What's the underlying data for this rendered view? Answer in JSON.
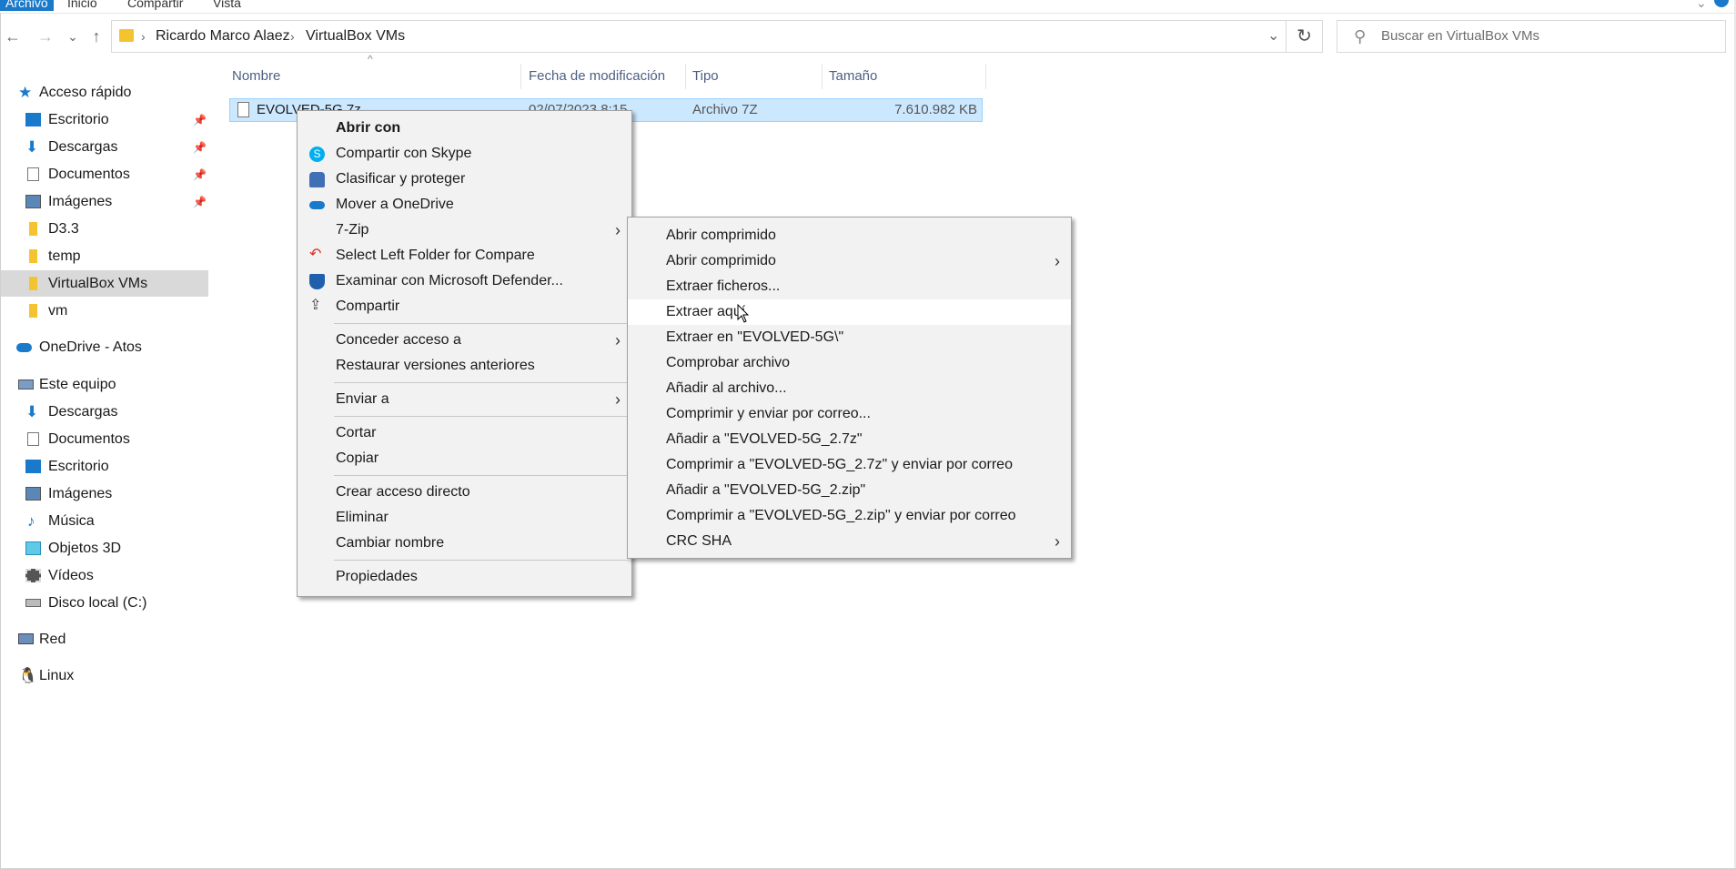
{
  "ribbon": {
    "tabs": [
      "Archivo",
      "Inicio",
      "Compartir",
      "Vista"
    ]
  },
  "address": {
    "segments": [
      "Ricardo Marco Alaez",
      "VirtualBox VMs"
    ]
  },
  "search": {
    "placeholder": "Buscar en VirtualBox VMs"
  },
  "sidebar": {
    "quick_access": "Acceso rápido",
    "quick_items": [
      "Escritorio",
      "Descargas",
      "Documentos",
      "Imágenes",
      "D3.3",
      "temp",
      "VirtualBox VMs",
      "vm"
    ],
    "onedrive": "OneDrive - Atos",
    "this_pc": "Este equipo",
    "pc_items": [
      "Descargas",
      "Documentos",
      "Escritorio",
      "Imágenes",
      "Música",
      "Objetos 3D",
      "Vídeos",
      "Disco local (C:)"
    ],
    "network": "Red",
    "linux": "Linux"
  },
  "columns": {
    "name": "Nombre",
    "date": "Fecha de modificación",
    "type": "Tipo",
    "size": "Tamaño"
  },
  "file": {
    "name": "EVOLVED-5G.7z",
    "date": "02/07/2023 8:15",
    "type": "Archivo 7Z",
    "size": "7.610.982 KB"
  },
  "context_menu": {
    "open_with": "Abrir con",
    "items_a": [
      "Compartir con Skype",
      "Clasificar y proteger",
      "Mover a OneDrive",
      "7-Zip",
      "Select Left Folder for Compare",
      "Examinar con Microsoft Defender...",
      "Compartir"
    ],
    "items_b": [
      "Conceder acceso a",
      "Restaurar versiones anteriores"
    ],
    "items_c": [
      "Enviar a"
    ],
    "items_d": [
      "Cortar",
      "Copiar"
    ],
    "items_e": [
      "Crear acceso directo",
      "Eliminar",
      "Cambiar nombre"
    ],
    "items_f": [
      "Propiedades"
    ]
  },
  "zip_menu": {
    "items": [
      "Abrir comprimido",
      "Abrir comprimido",
      "Extraer ficheros...",
      "Extraer aquí",
      "Extraer en \"EVOLVED-5G\\\"",
      "Comprobar archivo",
      "Añadir al archivo...",
      "Comprimir y enviar por correo...",
      "Añadir a \"EVOLVED-5G_2.7z\"",
      "Comprimir a \"EVOLVED-5G_2.7z\" y enviar por correo",
      "Añadir a \"EVOLVED-5G_2.zip\"",
      "Comprimir a \"EVOLVED-5G_2.zip\" y enviar por correo",
      "CRC SHA"
    ]
  },
  "colors": {
    "accent": "#1979ca",
    "selection": "#cce8ff",
    "menu_bg": "#f2f2f2"
  }
}
